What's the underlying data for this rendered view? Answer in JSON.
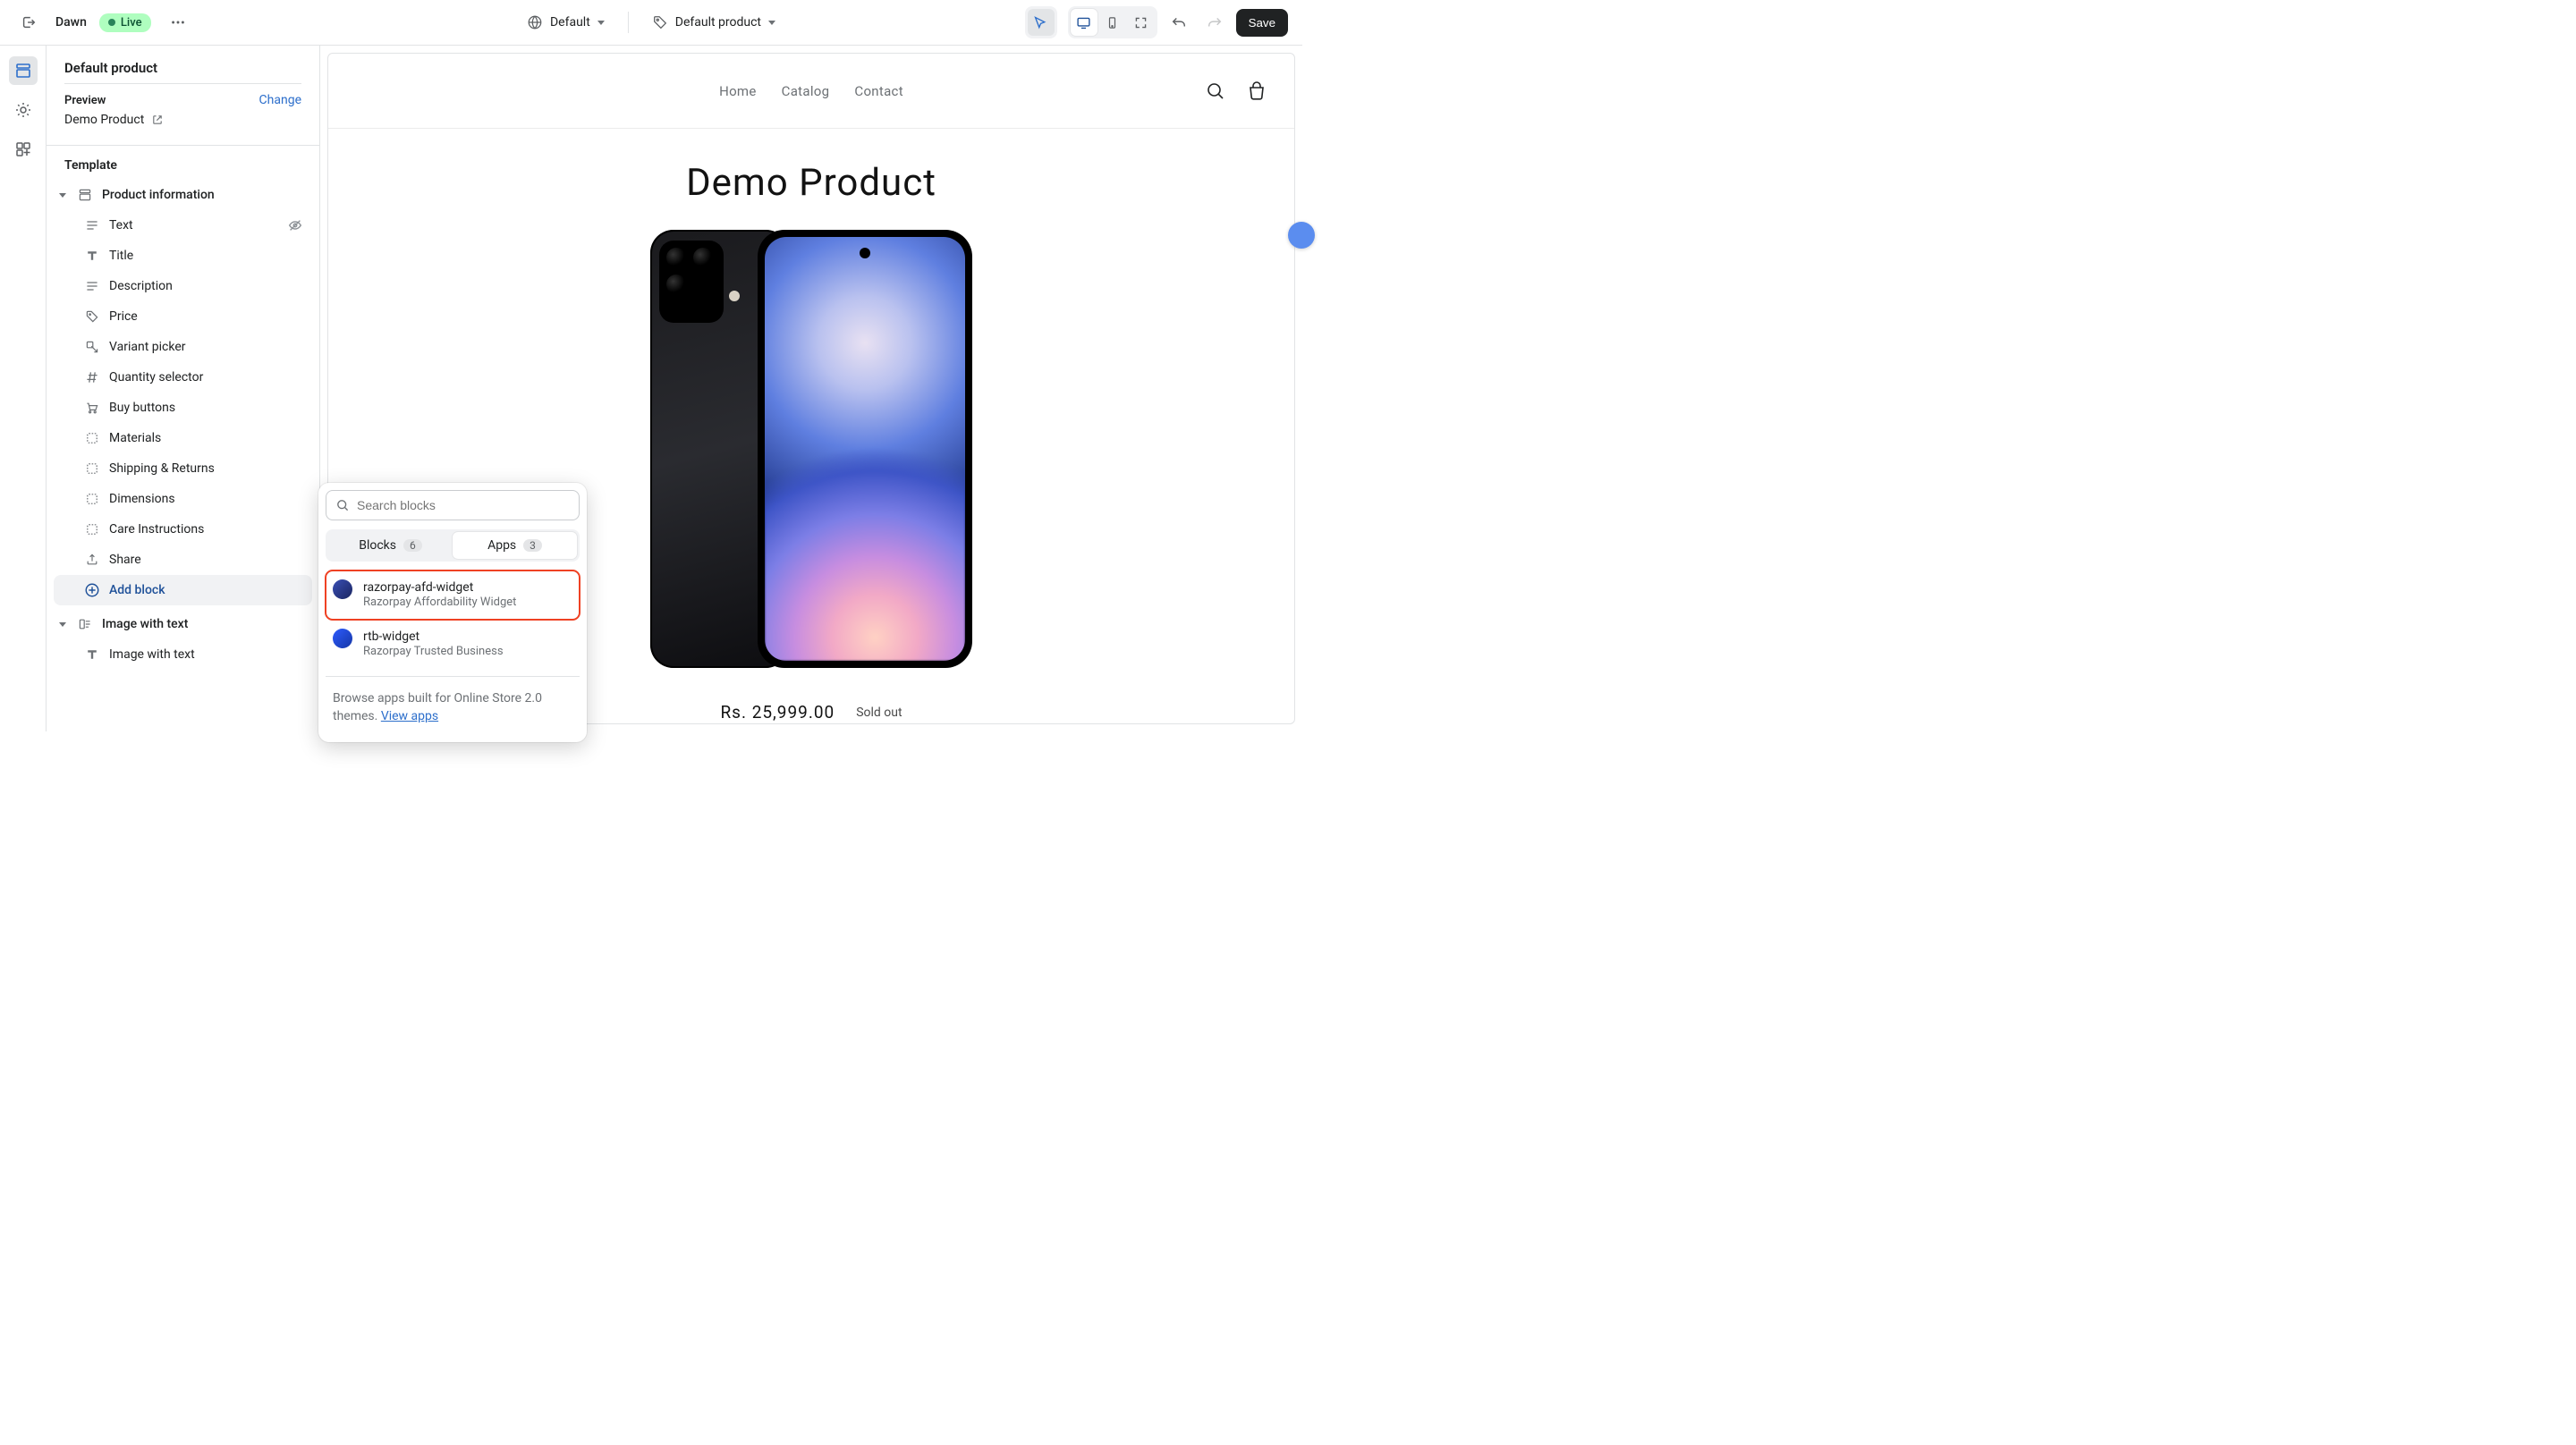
{
  "topbar": {
    "theme_name": "Dawn",
    "live_label": "Live",
    "default_label": "Default",
    "product_label": "Default product",
    "save_label": "Save"
  },
  "sidebar": {
    "title": "Default product",
    "preview_label": "Preview",
    "change_label": "Change",
    "preview_product": "Demo Product",
    "template_label": "Template",
    "sections": [
      {
        "label": "Product information"
      },
      {
        "label": "Image with text"
      }
    ],
    "blocks": [
      {
        "label": "Text",
        "icon": "text-lines",
        "hidden": true
      },
      {
        "label": "Title",
        "icon": "title"
      },
      {
        "label": "Description",
        "icon": "text-lines"
      },
      {
        "label": "Price",
        "icon": "price-tag"
      },
      {
        "label": "Variant picker",
        "icon": "variant"
      },
      {
        "label": "Quantity selector",
        "icon": "hash"
      },
      {
        "label": "Buy buttons",
        "icon": "cart"
      },
      {
        "label": "Materials",
        "icon": "collapsible"
      },
      {
        "label": "Shipping & Returns",
        "icon": "collapsible"
      },
      {
        "label": "Dimensions",
        "icon": "collapsible"
      },
      {
        "label": "Care Instructions",
        "icon": "collapsible"
      },
      {
        "label": "Share",
        "icon": "share"
      }
    ],
    "add_block_label": "Add block",
    "second_section_blocks": [
      {
        "label": "Image with text",
        "icon": "title"
      }
    ]
  },
  "popover": {
    "search_placeholder": "Search blocks",
    "tab_blocks_label": "Blocks",
    "tab_blocks_count": "6",
    "tab_apps_label": "Apps",
    "tab_apps_count": "3",
    "apps": [
      {
        "name": "razorpay-afd-widget",
        "subtitle": "Razorpay Affordability Widget"
      },
      {
        "name": "rtb-widget",
        "subtitle": "Razorpay Trusted Business"
      }
    ],
    "footer_text": "Browse apps built for Online Store 2.0 themes. ",
    "footer_link": "View apps"
  },
  "shop": {
    "nav": [
      "Home",
      "Catalog",
      "Contact"
    ],
    "title": "Demo Product",
    "price": "Rs. 25,999.00",
    "sold_out": "Sold out"
  }
}
